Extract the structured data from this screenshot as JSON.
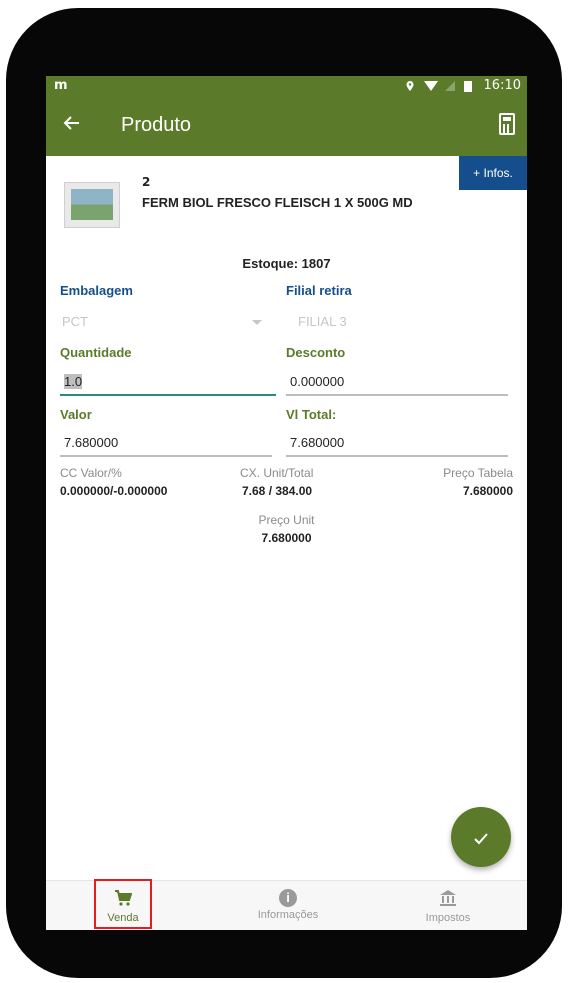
{
  "status_bar": {
    "left_text": "m",
    "time": "16:10"
  },
  "app_bar": {
    "back_icon": "arrow-left-icon",
    "title": "Produto",
    "calculator_icon": "calculator-icon"
  },
  "infos_button": "+ Infos.",
  "product": {
    "code": "2",
    "name": "FERM BIOL FRESCO FLEISCH 1 X 500G MD"
  },
  "estoque": "Estoque: 1807",
  "embalagem": {
    "label": "Embalagem",
    "value": "PCT"
  },
  "filial": {
    "label": "Filial retira",
    "value": "FILIAL 3"
  },
  "quantidade": {
    "label": "Quantidade",
    "value": "1.0"
  },
  "desconto": {
    "label": "Desconto",
    "value": "0.000000"
  },
  "valor": {
    "label": "Valor",
    "value": "7.680000"
  },
  "vl_total": {
    "label": "Vl Total:",
    "value": "7.680000"
  },
  "cc_valor": {
    "label": "CC Valor/%",
    "value": "0.000000/-0.000000"
  },
  "cx_unit": {
    "label": "CX. Unit/Total",
    "value": "7.68 / 384.00"
  },
  "preco_tabela": {
    "label": "Preço Tabela",
    "value": "7.680000"
  },
  "preco_unit": {
    "label": "Preço Unit",
    "value": "7.680000"
  },
  "fab_icon": "checkmark-icon",
  "bottom_nav": {
    "venda": {
      "label": "Venda",
      "icon": "cart-icon"
    },
    "informacoes": {
      "label": "Informações",
      "icon": "info-icon"
    },
    "impostos": {
      "label": "Impostos",
      "icon": "bank-icon"
    }
  },
  "colors": {
    "primary": "#5b7a2a",
    "accent_blue": "#154e8c",
    "active_underline": "#2b8a86",
    "highlight_border": "#e51c1c"
  }
}
